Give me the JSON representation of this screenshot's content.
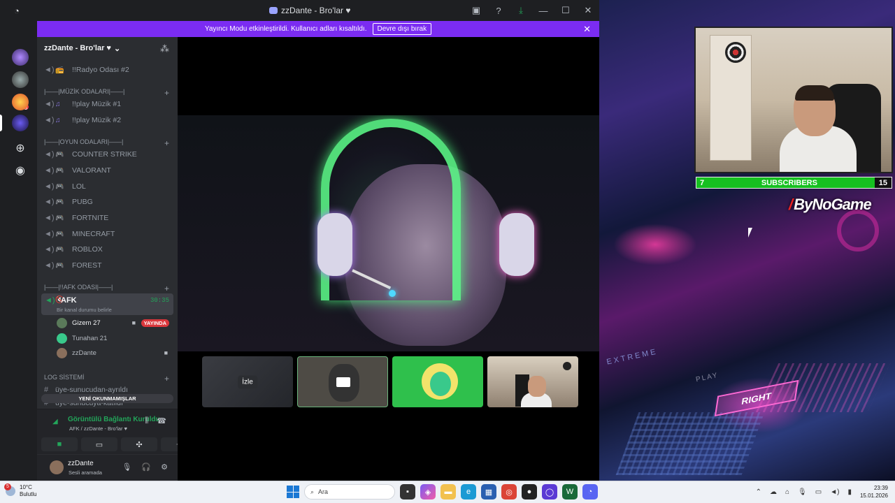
{
  "window": {
    "title": "zzDante - Bro'lar ♥",
    "icons": [
      "inbox-icon",
      "help-icon",
      "download-icon",
      "minimize-icon",
      "maximize-icon",
      "close-icon"
    ]
  },
  "banner": {
    "text": "Yayıncı Modu etkinleştirildi. Kullanıcı adları kısaltıldı.",
    "button": "Devre dışı bırak"
  },
  "server": {
    "name": "zzDante - Bro'lar ♥",
    "channels_top": [
      {
        "label": "!!Radyo Odası #2",
        "emoji": "📻"
      }
    ],
    "cat_music": "|——|MÜZİK ODALARI|——|",
    "music": [
      {
        "label": "!!play Müzik #1",
        "emoji": "🎵"
      },
      {
        "label": "!!play Müzik #2",
        "emoji": "🎵"
      }
    ],
    "cat_games": "|——|OYUN ODALARI|——|",
    "games": [
      {
        "label": "COUNTER STRIKE"
      },
      {
        "label": "VALORANT"
      },
      {
        "label": "LOL"
      },
      {
        "label": "PUBG"
      },
      {
        "label": "FORTNITE"
      },
      {
        "label": "MINECRAFT"
      },
      {
        "label": "ROBLOX"
      },
      {
        "label": "FOREST"
      }
    ],
    "cat_afk": "|——|!!AFK ODASI|——|",
    "afk": {
      "label": "AFK",
      "time": "30:35",
      "status": "Bir kanal durumu belirle"
    },
    "members": [
      {
        "name": "Gizem 27",
        "live": "YAYINDA"
      },
      {
        "name": "Tunahan 21"
      },
      {
        "name": "zzDante"
      }
    ],
    "cat_log": "LOG SİSTEMİ",
    "log_channels": [
      "üye-sunucudan-ayrıldı",
      "üye-sunucuya-katıldı"
    ],
    "new_unread": "YENİ OKUNMAMIŞLAR"
  },
  "voice": {
    "title": "Görüntülü Bağlantı Kuruldu",
    "sub": "AFK / zzDante - Bro'lar ♥"
  },
  "user": {
    "name": "zzDante",
    "status": "Sesli aramada"
  },
  "stage": {
    "watch_label": "İzle"
  },
  "overlay": {
    "sub_left": "7",
    "sub_label": "SUBSCRIBERS",
    "sub_right": "15",
    "brand": "ByNoGame",
    "wall_extreme": "EXTREME",
    "wall_play": "PLAY",
    "wall_right": "RIGHT"
  },
  "taskbar": {
    "temp": "10°C",
    "weather": "Bulutlu",
    "weather_badge": "5",
    "search": "Ara",
    "time": "23:39",
    "date": "15.01.2026"
  },
  "colors": {
    "banner": "#7b2cf2",
    "voice_green": "#23a55a",
    "live_red": "#da373c",
    "sub_green": "#16c020"
  }
}
